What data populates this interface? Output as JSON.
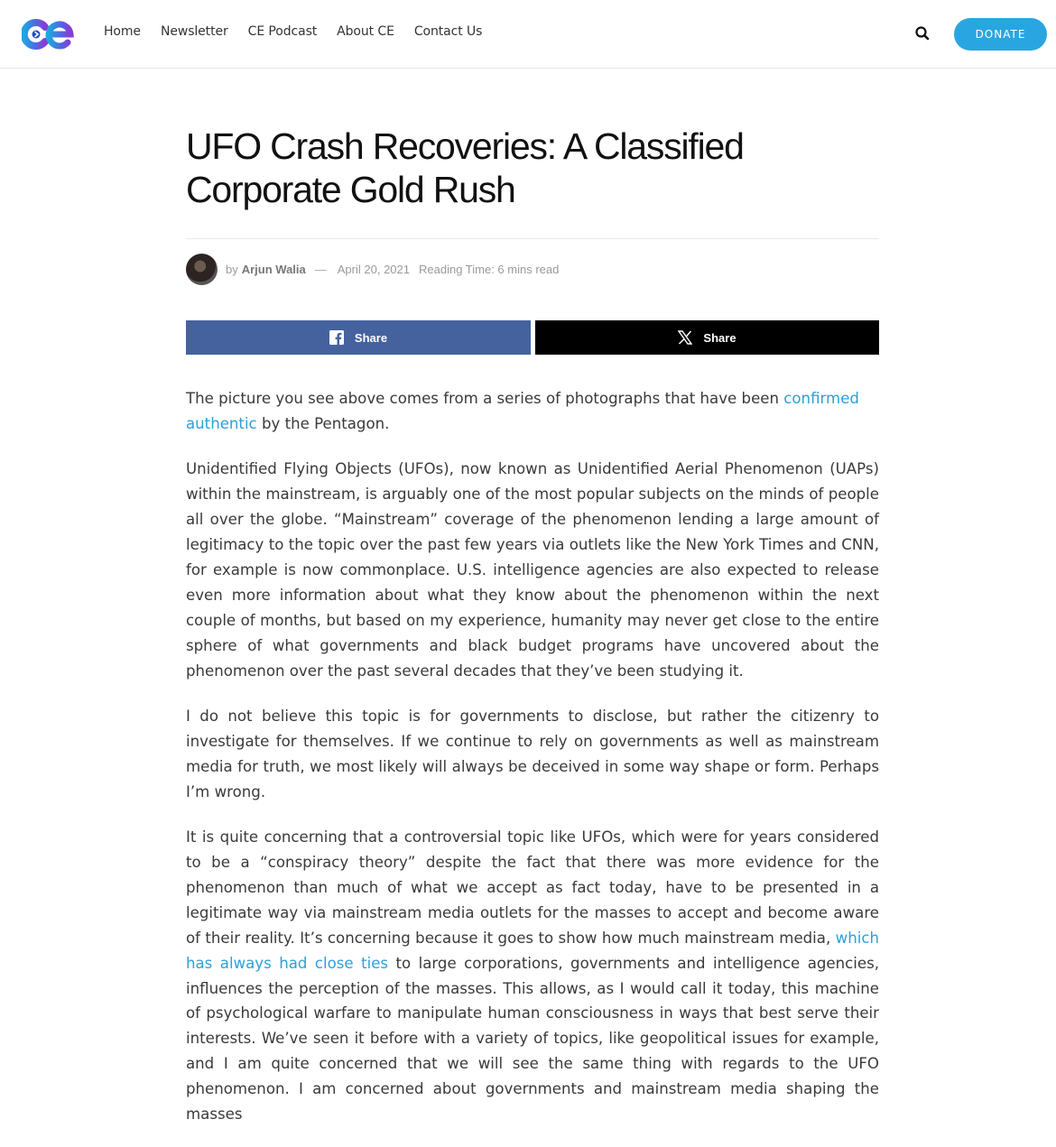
{
  "header": {
    "logo_text": "ce",
    "nav": [
      "Home",
      "Newsletter",
      "CE Podcast",
      "About CE",
      "Contact Us"
    ],
    "donate_label": "DONATE",
    "colors": {
      "accent": "#29a6e1",
      "logo_start": "#1fa6e0",
      "logo_end": "#8a3ad6"
    }
  },
  "article": {
    "title": "UFO Crash Recoveries: A Classified Corporate Gold Rush",
    "meta": {
      "by": "by",
      "author": "Arjun Walia",
      "dash": "—",
      "date": "April 20, 2021",
      "reading_time": "Reading Time: 6 mins read"
    },
    "share": {
      "facebook_label": "Share",
      "x_label": "Share",
      "facebook_icon": "facebook-icon",
      "x_icon": "x-icon"
    },
    "paragraphs": {
      "p1_a": "The picture you see above comes from a series of photographs that have been ",
      "p1_link": "confirmed authentic",
      "p1_b": " by the Pentagon.",
      "p2": "Unidentified Flying Objects (UFOs), now known as Unidentified Aerial Phenomenon (UAPs) within the mainstream, is arguably one of the most popular subjects on the minds of people all over the globe. “Mainstream” coverage of the phenomenon lending a large amount of legitimacy to the topic over the past few years via outlets like the New York Times and CNN, for example is now commonplace. U.S. intelligence agencies are also expected to release even more information about what they know about the phenomenon within the next couple of months, but based on my experience, humanity may never get close to the entire sphere of what governments and black budget programs have uncovered about the phenomenon over the past several decades that they’ve been studying it.",
      "p3": "I do not believe this topic is for governments to disclose, but rather the citizenry to investigate for themselves. If we continue to rely on governments as well as mainstream media for truth, we most likely will always be deceived in some way shape or form. Perhaps I’m wrong.",
      "p4_a": "It is quite concerning that a controversial topic like UFOs, which were for years considered to be a “conspiracy theory” despite the fact that there was more evidence for the phenomenon than much of what we accept as fact today, have to be presented in a legitimate way via mainstream media outlets for the masses to accept and become aware of their reality. It’s concerning because it goes to show how much mainstream media, ",
      "p4_link": "which has always had close ties",
      "p4_b": " to large corporations, governments and intelligence agencies, influences the perception of the masses. This allows, as I would call it today, this machine of psychological warfare to manipulate human consciousness in ways that best serve their interests. We’ve seen it before with a variety of topics, like geopolitical issues for example, and I am quite concerned that we will see the same thing with regards to the UFO phenomenon. I am concerned about governments and mainstream media shaping the masses"
    }
  }
}
